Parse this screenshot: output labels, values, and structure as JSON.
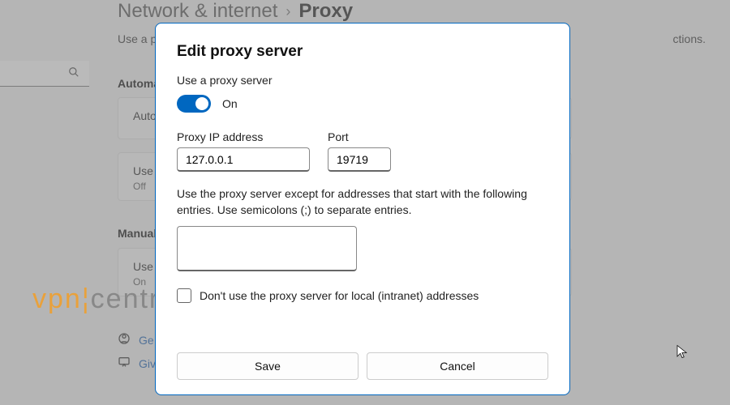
{
  "breadcrumb": {
    "parent": "Network & internet",
    "current": "Proxy"
  },
  "bg": {
    "desc_left": "Use a pro",
    "desc_right": "ctions.",
    "section_auto": "Automa",
    "section_manual": "Manual",
    "card_auto": "Auto",
    "card_script": "Use s",
    "card_script_sub": "Off",
    "card_proxy": "Use a",
    "card_proxy_sub": "On",
    "link_get": "Ge",
    "link_give": "Giv"
  },
  "dialog": {
    "title": "Edit proxy server",
    "use_label": "Use a proxy server",
    "toggle_state": "On",
    "ip_label": "Proxy IP address",
    "ip_value": "127.0.0.1",
    "port_label": "Port",
    "port_value": "19719",
    "except_label": "Use the proxy server except for addresses that start with the following entries. Use semicolons (;) to separate entries.",
    "except_value": "",
    "local_label": "Don't use the proxy server for local (intranet) addresses",
    "save": "Save",
    "cancel": "Cancel"
  },
  "watermark": {
    "part1": "vpn",
    "part2": "central"
  }
}
